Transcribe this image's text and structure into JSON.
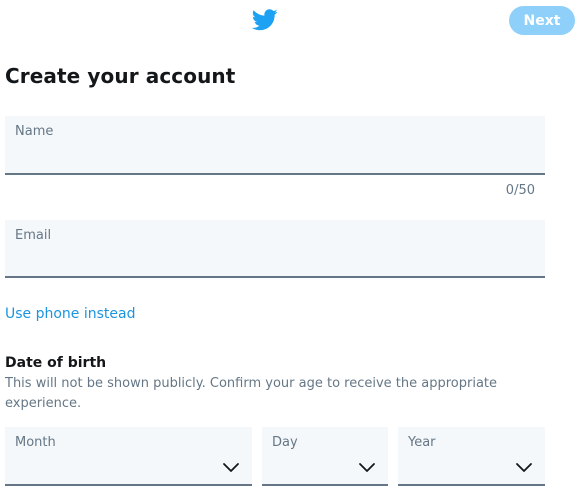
{
  "header": {
    "logo_icon": "twitter-bird-icon",
    "next_label": "Next"
  },
  "page": {
    "title": "Create your account"
  },
  "form": {
    "name": {
      "label": "Name",
      "value": "",
      "counter": "0/50"
    },
    "email": {
      "label": "Email",
      "value": ""
    },
    "phone_link": "Use phone instead",
    "dob": {
      "title": "Date of birth",
      "description": "This will not be shown publicly. Confirm your age to receive the appropriate experience.",
      "month_label": "Month",
      "day_label": "Day",
      "year_label": "Year",
      "chevron_icon": "chevron-down-icon"
    }
  },
  "colors": {
    "brand": "#1da1f2",
    "next_disabled": "#8ed0f9",
    "link": "#1b95e0",
    "field_bg": "#f5f8fa",
    "muted_text": "#657786",
    "text": "#14171a"
  }
}
